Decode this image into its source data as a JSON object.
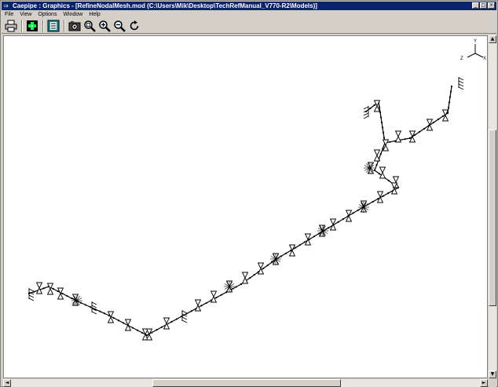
{
  "window": {
    "title": "Caepipe : Graphics - [RefineNodalMesh.mod (C:\\Users\\Mik\\Desktop\\TechRefManual_V770-R2\\Models)]",
    "title_icon": "pipe-app-icon",
    "minimize_glyph": "_",
    "maximize_glyph": "□",
    "close_glyph": "×"
  },
  "menu": {
    "items": [
      {
        "label": "File"
      },
      {
        "label": "View"
      },
      {
        "label": "Options"
      },
      {
        "label": "Window"
      },
      {
        "label": "Help"
      }
    ]
  },
  "toolbar": {
    "buttons": [
      {
        "icon": "print-icon"
      },
      {
        "icon": "node-toggle-icon"
      },
      {
        "icon": "layout-icon"
      },
      {
        "icon": "camera-icon"
      },
      {
        "icon": "zoom-window-icon"
      },
      {
        "icon": "zoom-in-icon"
      },
      {
        "icon": "zoom-out-icon"
      },
      {
        "icon": "rotate-icon"
      }
    ]
  },
  "triad": {
    "y": "Y",
    "z": "Z",
    "x": "X"
  },
  "colors": {
    "titlebar": "#0a246a",
    "chrome": "#d4d0c8",
    "canvas": "#ffffff",
    "pipe": "#000000"
  }
}
